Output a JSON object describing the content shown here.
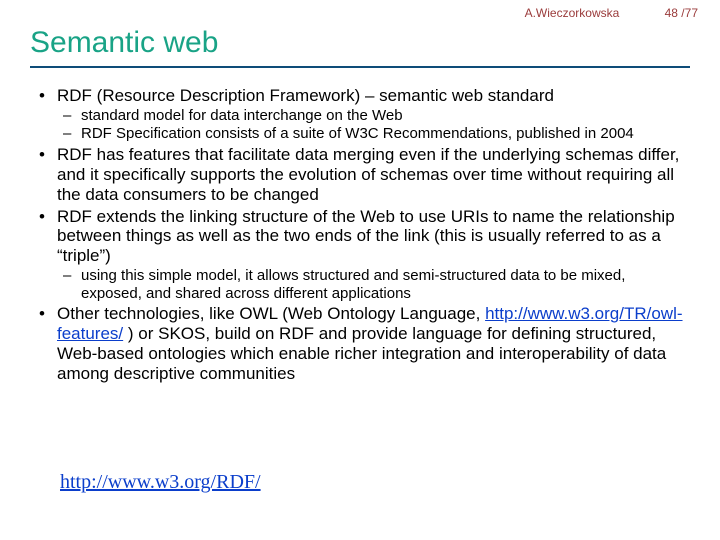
{
  "meta": {
    "author": "A.Wieczorkowska",
    "page": "48 /77"
  },
  "title": "Semantic web",
  "bullets": {
    "b1": "RDF (Resource Description Framework) – semantic web standard",
    "b1_subs": {
      "s1": "standard model for data interchange on the Web",
      "s2": "RDF Specification consists of a suite of W3C Recommendations, published in 2004"
    },
    "b2": "RDF has features that facilitate data merging even if the underlying schemas differ, and it specifically supports the evolution of schemas over time without requiring all the data consumers to be changed",
    "b3": "RDF extends the linking structure of the Web to use URIs to name the relationship between things as well as the two ends of the link (this is usually referred to as a “triple”)",
    "b3_subs": {
      "s1": "using this simple model, it allows structured and semi-structured data to be mixed, exposed, and shared across different applications"
    },
    "b4_pre": "Other technologies, like OWL (Web Ontology Language, ",
    "b4_link": "http://www.w3.org/TR/owl-features/",
    "b4_post": " ) or SKOS, build on RDF and provide language for defining structured, Web-based ontologies which enable richer integration and interoperability of data among descriptive communities"
  },
  "footer_link": "http://www.w3.org/RDF/"
}
